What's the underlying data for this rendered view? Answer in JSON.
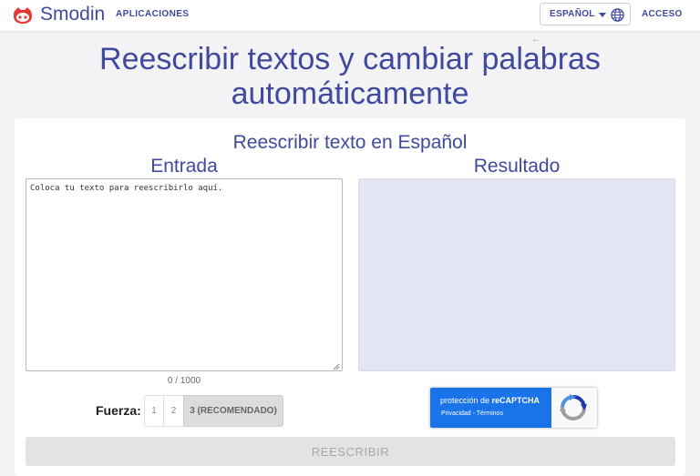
{
  "header": {
    "logo_text": "Smodin",
    "apps_label": "APLICACIONES",
    "language_label": "ESPAÑOL",
    "login_label": "ACCESO"
  },
  "hero": {
    "title_line1": "Reescribir textos y cambiar palabras",
    "title_line2": "automáticamente"
  },
  "tool": {
    "subtitle": "Reescribir texto en Español",
    "input_label": "Entrada",
    "output_label": "Resultado",
    "input_placeholder": "Coloca tu texto para reescribirlo aquí.",
    "input_value": "",
    "output_value": "",
    "char_count": "0 / 1000",
    "strength_label": "Fuerza:",
    "strength_options": [
      "1",
      "2",
      "3 (RECOMENDADO)"
    ],
    "selected_strength": "3 (RECOMENDADO)",
    "submit_label": "REESCRIBIR"
  },
  "recaptcha": {
    "line1_prefix": "protección de ",
    "line1_brand": "reCAPTCHA",
    "line2": "Privacidad - Términos"
  },
  "colors": {
    "brand": "#3f4a9e",
    "logo_red": "#e53935",
    "recaptcha_blue": "#1a73e8",
    "output_bg": "#e3e4f4"
  },
  "icons": [
    "smodin-logo-icon",
    "caret-down-icon",
    "globe-icon",
    "resize-grip-icon",
    "recaptcha-logo-icon",
    "back-arrow-icon"
  ]
}
